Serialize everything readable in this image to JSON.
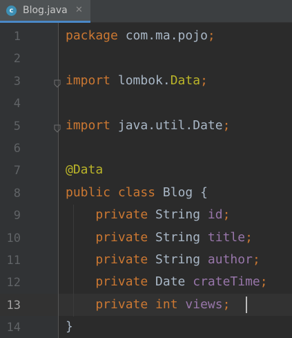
{
  "tab": {
    "icon": "c-class-icon",
    "icon_letter": "c",
    "label": "Blog.java",
    "close": "✕"
  },
  "editor": {
    "active_line": 13,
    "lines": [
      {
        "n": "1",
        "tokens": [
          {
            "t": "package ",
            "c": "kw"
          },
          {
            "t": "com.ma.pojo",
            "c": "id"
          },
          {
            "t": ";",
            "c": "kw"
          }
        ]
      },
      {
        "n": "2",
        "tokens": []
      },
      {
        "n": "3",
        "fold": true,
        "tokens": [
          {
            "t": "import ",
            "c": "kw"
          },
          {
            "t": "lombok.",
            "c": "id"
          },
          {
            "t": "Data",
            "c": "ann"
          },
          {
            "t": ";",
            "c": "kw"
          }
        ]
      },
      {
        "n": "4",
        "tokens": []
      },
      {
        "n": "5",
        "fold": true,
        "tokens": [
          {
            "t": "import ",
            "c": "kw"
          },
          {
            "t": "java.util.Date",
            "c": "id"
          },
          {
            "t": ";",
            "c": "kw"
          }
        ]
      },
      {
        "n": "6",
        "tokens": []
      },
      {
        "n": "7",
        "tokens": [
          {
            "t": "@Data",
            "c": "ann"
          }
        ]
      },
      {
        "n": "8",
        "tokens": [
          {
            "t": "public class ",
            "c": "kw"
          },
          {
            "t": "Blog {",
            "c": "id"
          }
        ]
      },
      {
        "n": "9",
        "tokens": [
          {
            "t": "    private ",
            "c": "kw"
          },
          {
            "t": "String ",
            "c": "cls"
          },
          {
            "t": "id",
            "c": "fld"
          },
          {
            "t": ";",
            "c": "kw"
          }
        ]
      },
      {
        "n": "10",
        "tokens": [
          {
            "t": "    private ",
            "c": "kw"
          },
          {
            "t": "String ",
            "c": "cls"
          },
          {
            "t": "title",
            "c": "fld"
          },
          {
            "t": ";",
            "c": "kw"
          }
        ]
      },
      {
        "n": "11",
        "tokens": [
          {
            "t": "    private ",
            "c": "kw"
          },
          {
            "t": "String ",
            "c": "cls"
          },
          {
            "t": "author",
            "c": "fld"
          },
          {
            "t": ";",
            "c": "kw"
          }
        ]
      },
      {
        "n": "12",
        "tokens": [
          {
            "t": "    private ",
            "c": "kw"
          },
          {
            "t": "Date ",
            "c": "cls"
          },
          {
            "t": "crateTime",
            "c": "fld"
          },
          {
            "t": ";",
            "c": "kw"
          }
        ]
      },
      {
        "n": "13",
        "tokens": [
          {
            "t": "    private ",
            "c": "kw"
          },
          {
            "t": "int ",
            "c": "kw"
          },
          {
            "t": "views",
            "c": "fld"
          },
          {
            "t": ";",
            "c": "kw"
          }
        ]
      },
      {
        "n": "14",
        "tokens": [
          {
            "t": "}",
            "c": "id"
          }
        ]
      }
    ]
  },
  "colors": {
    "background": "#2b2b2b",
    "gutter": "#313335",
    "keyword": "#cc7832",
    "annotation": "#bbb529",
    "field": "#9876aa",
    "text": "#a9b7c6",
    "line_number": "#606366"
  }
}
